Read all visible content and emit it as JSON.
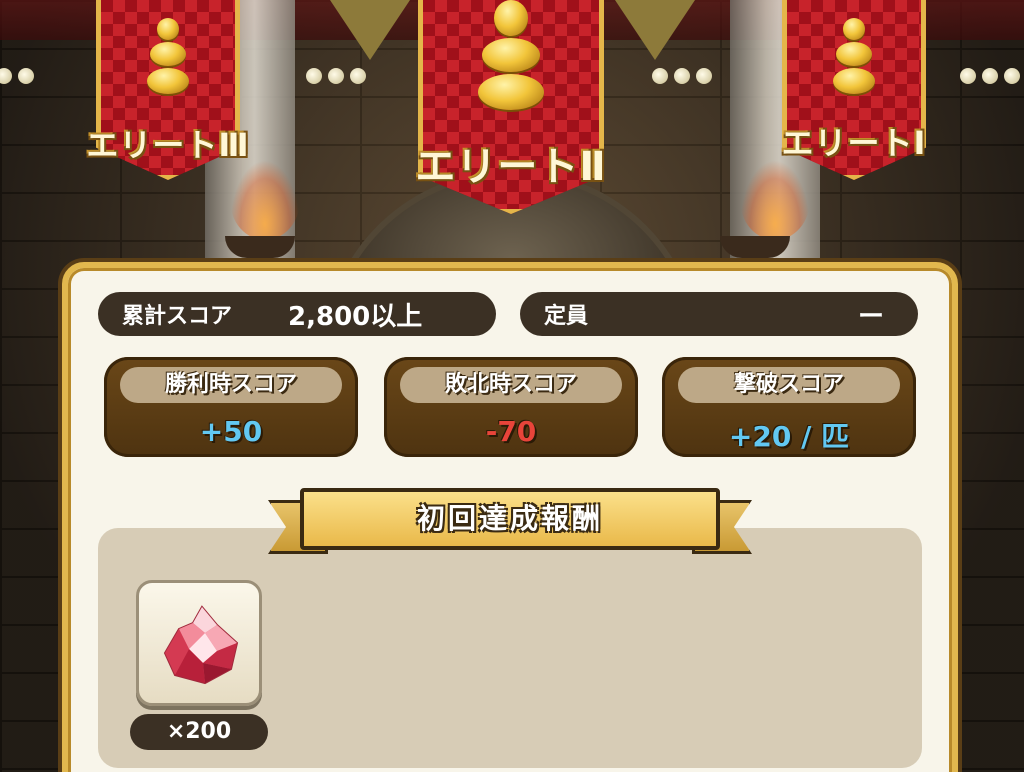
{
  "ranks": {
    "left": "エリートⅢ",
    "center": "エリートⅡ",
    "right": "エリートⅠ"
  },
  "summary": {
    "total_score_label": "累計スコア",
    "total_score_value": "2,800以上",
    "capacity_label": "定員",
    "capacity_value": "ー"
  },
  "scores": [
    {
      "label": "勝利時スコア",
      "value": "+50",
      "color": "#62c8f2"
    },
    {
      "label": "敗北時スコア",
      "value": "-70",
      "color": "#e8443a"
    },
    {
      "label": "撃破スコア",
      "value": "+20 / 匹",
      "color": "#62c8f2"
    }
  ],
  "reward": {
    "title": "初回達成報酬",
    "item_icon": "red-gem-icon",
    "quantity": "×200"
  },
  "colors": {
    "gold": "#e2b84e",
    "banner_red": "#a0101a",
    "panel_bg": "#f8f5ea",
    "dark_pill": "#3b3024"
  }
}
